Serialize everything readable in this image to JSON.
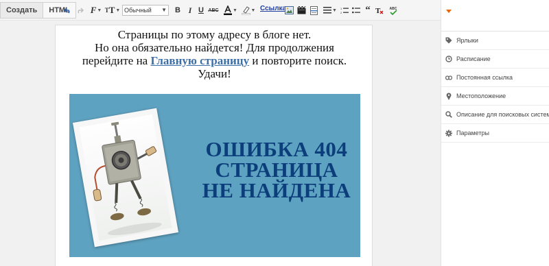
{
  "toolbar": {
    "tabs": [
      "Создать",
      "HTML"
    ],
    "style_select": "Обычный",
    "link_label": "Ссылка"
  },
  "content": {
    "line1": "Страницы по этому адресу в блоге нет.",
    "line2": "Но она обязательно найдется! Для продолжения",
    "line3_before": "перейдите на ",
    "homepage_link": "Главную страницу",
    "line3_after": " и повторите поиск.",
    "line4": "Удачи!",
    "banner": {
      "line1": "ОШИБКА 404",
      "line2": "СТРАНИЦА",
      "line3": "НЕ НАЙДЕНА"
    }
  },
  "sidebar": {
    "items": [
      {
        "label": "Ярлыки",
        "icon": "tag-icon"
      },
      {
        "label": "Расписание",
        "icon": "clock-icon"
      },
      {
        "label": "Постоянная ссылка",
        "icon": "link-icon"
      },
      {
        "label": "Местоположение",
        "icon": "location-pin-icon"
      },
      {
        "label": "Описание для поисковых систем",
        "icon": "search-icon"
      },
      {
        "label": "Параметры",
        "icon": "gear-icon"
      }
    ]
  },
  "colors": {
    "accent": "#ee6500",
    "banner_bg": "#5ea2c1",
    "banner_text": "#0b3e7b",
    "link": "#3c6fa8"
  }
}
